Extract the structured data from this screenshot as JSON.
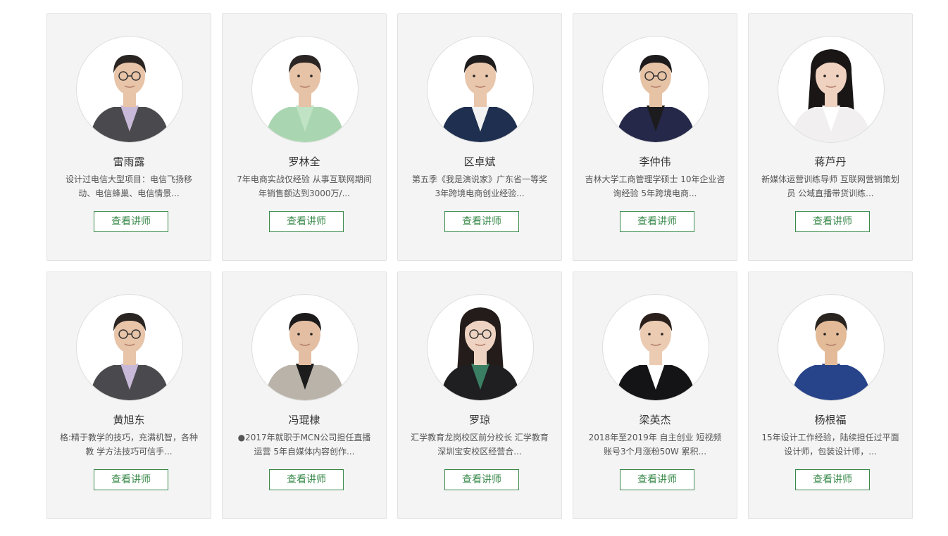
{
  "button_label": "查看讲师",
  "accent_color": "#3a8a4b",
  "teachers": [
    {
      "name": "雷雨露",
      "intro": "设计过电信大型项目：电信飞扬移动、电信蜂巢、电信情景...",
      "avatar_icon": "portrait-man-glasses-grey-suit"
    },
    {
      "name": "罗林全",
      "intro": "7年电商实战仅经验 从事互联网期间年销售额达到3000万/...",
      "avatar_icon": "portrait-man-mint-shirt"
    },
    {
      "name": "区卓斌",
      "intro": "第五季《我是演说家》广东省一等奖 3年跨境电商创业经验...",
      "avatar_icon": "portrait-man-navy-blazer"
    },
    {
      "name": "李仲伟",
      "intro": "吉林大学工商管理学硕士 10年企业咨询经验 5年跨境电商...",
      "avatar_icon": "portrait-man-glasses-navy-coat"
    },
    {
      "name": "蒋芦丹",
      "intro": "新媒体运营训练导师 互联网营销策划员 公域直播带货训练...",
      "avatar_icon": "portrait-woman-white-blouse"
    },
    {
      "name": "黄旭东",
      "intro": "格:精于教学的技巧，充满机智，各种教 学方法技巧可信手...",
      "avatar_icon": "portrait-man-glasses-grey-suit"
    },
    {
      "name": "冯琨棣",
      "intro": "●2017年就职于MCN公司担任直播运营 5年自媒体内容创作...",
      "avatar_icon": "portrait-man-grey-jacket"
    },
    {
      "name": "罗琼",
      "intro": "汇学教育龙岗校区前分校长 汇学教育深圳宝安校区经营合...",
      "avatar_icon": "portrait-woman-glasses-black-suit"
    },
    {
      "name": "梁英杰",
      "intro": "2018年至2019年 自主创业 短视频账号3个月涨粉50W 累积...",
      "avatar_icon": "portrait-man-tuxedo-bowtie"
    },
    {
      "name": "杨根福",
      "intro": "15年设计工作经验，陆续担任过平面设计师，包装设计师，...",
      "avatar_icon": "portrait-man-blue-shirt-thumbs-up"
    }
  ]
}
